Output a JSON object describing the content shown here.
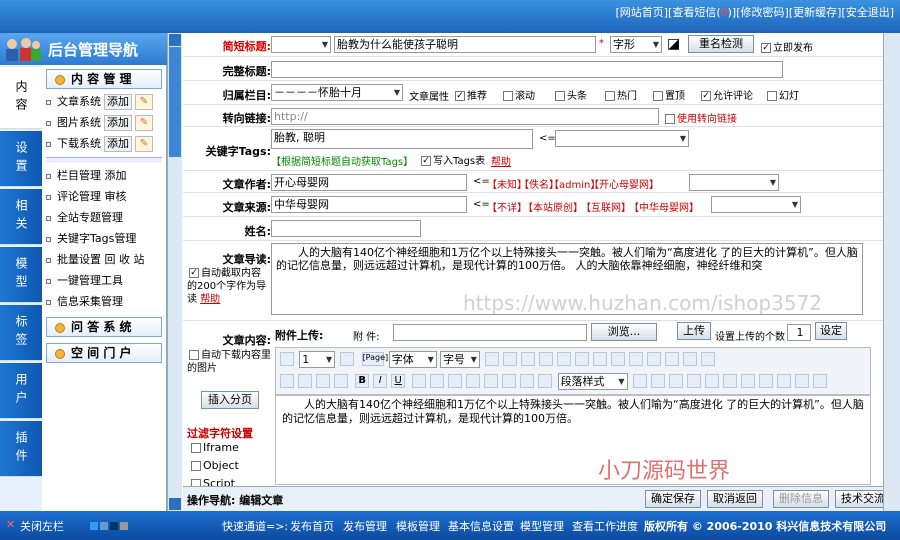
{
  "top_links": [
    "[网站首页]",
    "[查看短信(",
    "0",
    ")]",
    "[修改密码]",
    "[更新缓存]",
    "[安全退出]"
  ],
  "sidebar_title": "后台管理导航",
  "vtabs": [
    "内容",
    "设置",
    "相关",
    "模型",
    "标签",
    "用户",
    "插件"
  ],
  "sections": {
    "content": "内 容 管 理",
    "ask": "问 答 系 统",
    "portal": "空 间 门 户"
  },
  "content_items": [
    {
      "label": "文章系统",
      "add": "添加"
    },
    {
      "label": "图片系统",
      "add": "添加"
    },
    {
      "label": "下载系统",
      "add": "添加"
    }
  ],
  "nav_items": [
    "栏目管理 添加",
    "评论管理 审核",
    "全站专题管理",
    "关键字Tags管理",
    "批量设置 回 收 站",
    "一键管理工具",
    "信息采集管理"
  ],
  "form": {
    "short_title_label": "简短标题:",
    "short_title_value": "胎教为什么能使孩子聪明",
    "font_select": "字形",
    "dup_check": "重名检测",
    "publish_now": "立即发布",
    "full_title_label": "完整标题:",
    "category_label": "归属栏目:",
    "category_value": "－－－－怀胎十月",
    "attr_label": "文章属性",
    "attrs": [
      "推荐",
      "滚动",
      "头条",
      "热门",
      "置顶",
      "允许评论",
      "幻灯"
    ],
    "redirect_label": "转向链接:",
    "redirect_placeholder": "http://",
    "redirect_use": "使用转向链接",
    "tags_label": "关键字Tags:",
    "tags_value": "胎教, 聪明",
    "tags_auto": "【根据简短标题自动获取Tags】",
    "tags_write": "写入Tags表",
    "help": "帮助",
    "author_label": "文章作者:",
    "author_value": "开心母婴网",
    "author_opts": [
      "【未知】",
      "【佚名】",
      "【admin】",
      "【开心母婴网】"
    ],
    "source_label": "文章来源:",
    "source_value": "中华母婴网",
    "source_opts": [
      "【不详】",
      "【本站原创】",
      "【互联网】",
      "【中华母婴网】"
    ],
    "name_label": "姓名:",
    "intro_label": "文章导读:",
    "intro_text": "人的大脑有140亿个神经细胞和1万亿个以上特殊接头一一突触。被人们喻为“高度进化 了的巨大的计算机”。但人脑的记忆信息量，则远远超过计算机，是现代计算的100万倍。 人的大脑依靠神经细胞，神经纤维和突",
    "auto_intro": "自动截取内容的200个字作为导读",
    "content_label": "文章内容:",
    "upload_label": "附件上传:",
    "attach_label": "附 件:",
    "browse": "浏览...",
    "upload_btn": "上传",
    "upload_count_label": "设置上传的个数",
    "upload_count": "1",
    "set_btn": "设定",
    "auto_download": "自动下载内容里的图片",
    "insert_page": "插入分页",
    "filter_title": "过滤字符设置",
    "filters": [
      "Iframe",
      "Object",
      "Script"
    ],
    "editor_font": "字体",
    "editor_size": "字号",
    "editor_num": "1",
    "editor_para": "段落样式",
    "editor_text": "人的大脑有140亿个神经细胞和1万亿个以上特殊接头一一突触。被人们喻为“高度进化 了的巨大的计算机”。但人脑的记忆信息量，则远远超过计算机，是现代计算的100万倍。",
    "page_label": "[Page]"
  },
  "op_nav": "操作导航: 编辑文章",
  "actions": [
    "确定保存",
    "取消返回",
    "删除信息",
    "技术交流"
  ],
  "brand": "小刀源码世界",
  "watermark": "https://www.huzhan.com/ishop3572",
  "footer": {
    "close_left": "关闭左栏",
    "quick": "快速通道=>:",
    "links": [
      "发布首页",
      "发布管理",
      "模板管理",
      "基本信息设置",
      "模型管理",
      "查看工作进度"
    ],
    "copyright": "版权所有 © 2006-2010 科兴信息技术有限公司"
  }
}
